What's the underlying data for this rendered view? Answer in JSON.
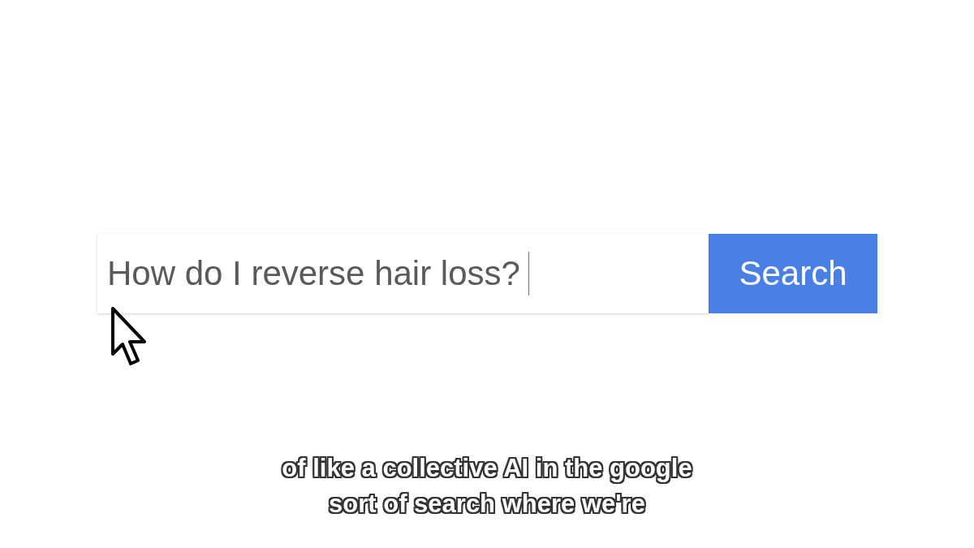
{
  "search": {
    "value": "How do I reverse hair loss?",
    "button": "Search"
  },
  "captions": [
    "of like a collective AI in the google",
    "sort of search where we're"
  ]
}
